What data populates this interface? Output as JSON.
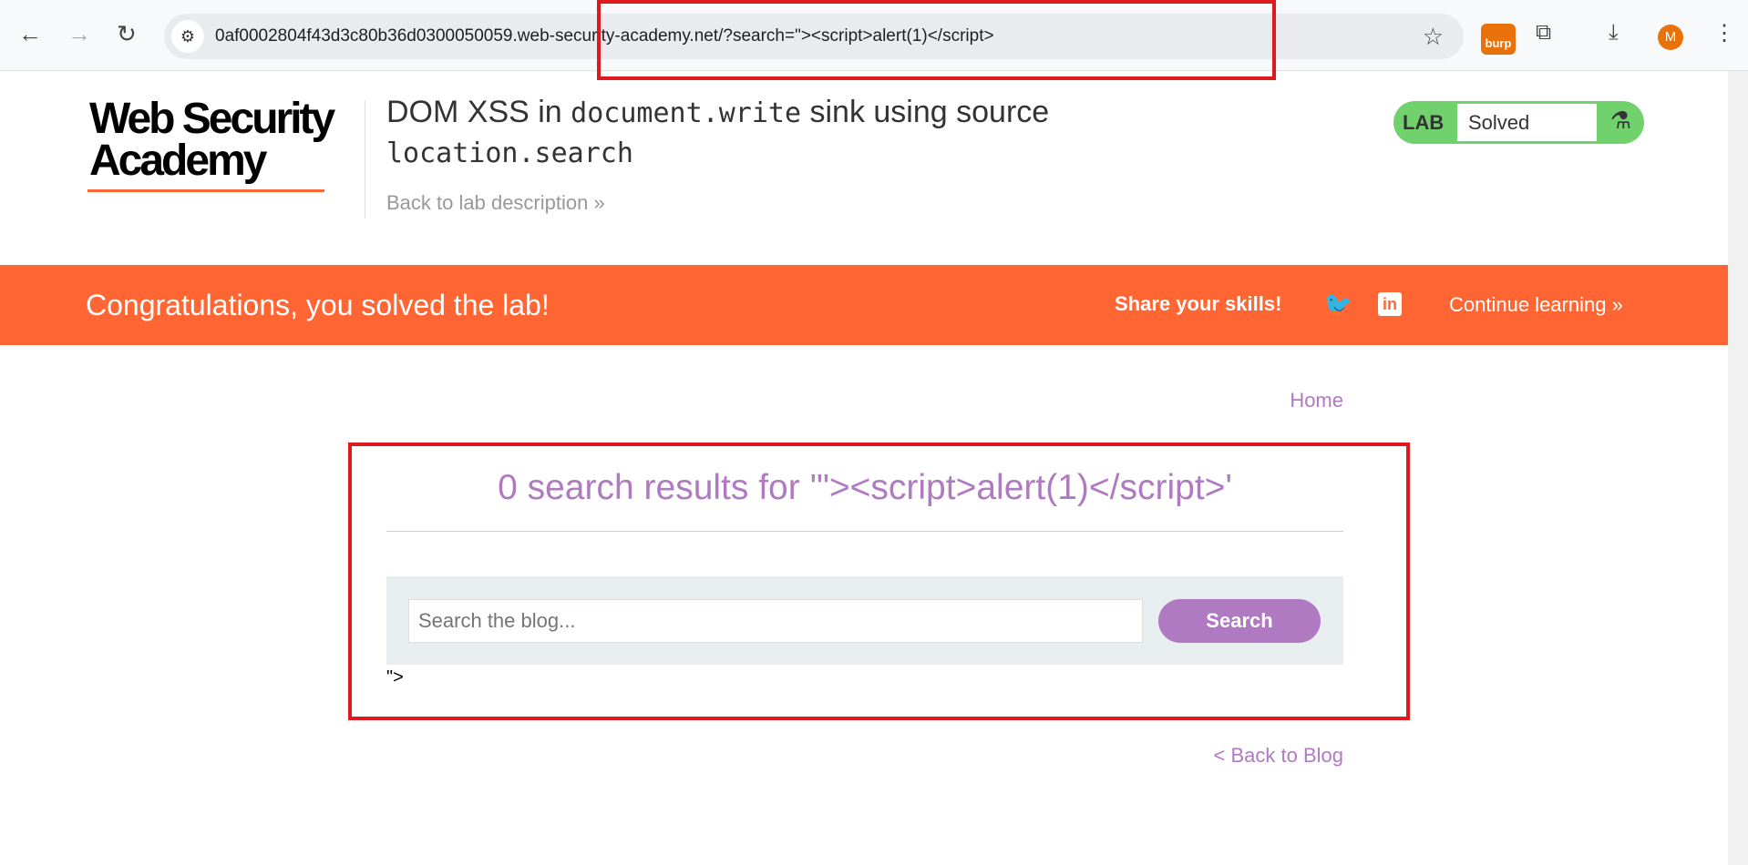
{
  "browser": {
    "url": "0af0002804f43d3c80b36d0300050059.web-security-academy.net/?search=\"><script>alert(1)</script>",
    "burp_label": "burp",
    "profile_initial": "M"
  },
  "header": {
    "logo_line1": "Web Security",
    "logo_line2": "Academy",
    "title_prefix": "DOM XSS in ",
    "title_code1": "document.write",
    "title_mid": " sink using source",
    "title_code2": "location.search",
    "back_link": "Back to lab description »",
    "lab_label": "LAB",
    "lab_status": "Solved"
  },
  "banner": {
    "message": "Congratulations, you solved the lab!",
    "share": "Share your skills!",
    "linkedin": "in",
    "continue": "Continue learning »"
  },
  "main": {
    "home": "Home",
    "heading": "0 search results for '\"><script>alert(1)</script>'",
    "search_placeholder": "Search the blog...",
    "search_button": "Search",
    "residue": "\">",
    "back_to_blog": "< Back to Blog"
  },
  "colors": {
    "accent": "#ff6633",
    "link": "#b07ac3",
    "lab_green": "#70d16d",
    "annotation": "#e0191f"
  }
}
